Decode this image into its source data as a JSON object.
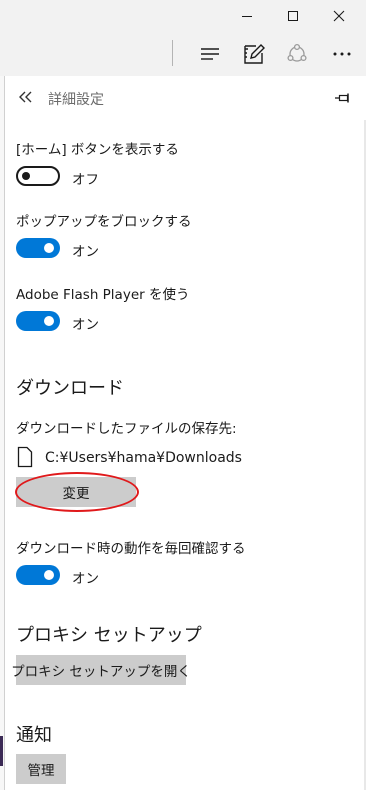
{
  "panel": {
    "title": "詳細設定",
    "back_icon": "double-chevron-left-icon",
    "pin_icon": "pin-icon"
  },
  "settings": {
    "home_button": {
      "label": "[ホーム] ボタンを表示する",
      "state": "オフ",
      "enabled": false
    },
    "block_popups": {
      "label": "ポップアップをブロックする",
      "state": "オン",
      "enabled": true
    },
    "flash": {
      "label": "Adobe Flash Player を使う",
      "state": "オン",
      "enabled": true
    }
  },
  "downloads": {
    "heading": "ダウンロード",
    "location_label": "ダウンロードしたファイルの保存先:",
    "path": "C:¥Users¥hama¥Downloads",
    "change_button": "変更",
    "confirm_label": "ダウンロード時の動作を毎回確認する",
    "confirm_state": "オン",
    "confirm_enabled": true
  },
  "proxy": {
    "heading": "プロキシ セットアップ",
    "button": "プロキシ セットアップを開く"
  },
  "notifications": {
    "heading": "通知",
    "button": "管理"
  },
  "colors": {
    "accent": "#0078d7",
    "highlight": "#e0191b",
    "chrome": "#f2f2f2",
    "button": "#cccccc"
  }
}
